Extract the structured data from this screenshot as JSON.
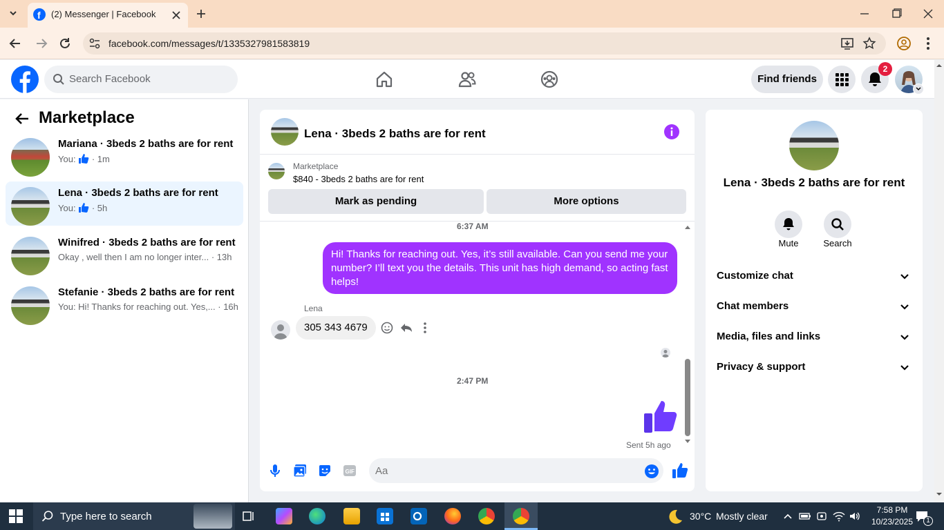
{
  "browser": {
    "tab_title": "(2) Messenger | Facebook",
    "url": "facebook.com/messages/t/1335327981583819"
  },
  "fb": {
    "search_placeholder": "Search Facebook",
    "find_friends": "Find friends",
    "notification_count": "2"
  },
  "left": {
    "title": "Marketplace",
    "conversations": [
      {
        "title": "Mariana · 3beds 2 baths are for rent",
        "prefix": "You:",
        "time": "· 1m"
      },
      {
        "title": "Lena · 3beds 2 baths are for rent",
        "prefix": "You:",
        "time": "· 5h"
      },
      {
        "title": "Winifred · 3beds 2 baths are for rent",
        "snippet": "Okay , well then I am no longer inter... · 13h"
      },
      {
        "title": "Stefanie · 3beds 2 baths are for rent",
        "snippet": "You: Hi! Thanks for reaching out. Yes,... · 16h"
      }
    ]
  },
  "chat": {
    "title": "Lena · 3beds 2 baths are for rent",
    "listing_source": "Marketplace",
    "listing_title": "$840 - 3beds 2 baths are for rent",
    "mark_pending": "Mark as pending",
    "more_options": "More options",
    "time1": "6:37 AM",
    "outgoing_message": "Hi! Thanks for reaching out. Yes, it’s still available. Can you send me your number? I’ll text you the details. This unit has high demand, so acting fast helps!",
    "sender_name": "Lena",
    "incoming_message": "305 343 4679",
    "time2": "2:47 PM",
    "sent_status": "Sent 5h ago",
    "input_placeholder": "Aa"
  },
  "right": {
    "name": "Lena · 3beds 2 baths are for rent",
    "mute": "Mute",
    "search": "Search",
    "sections": [
      "Customize chat",
      "Chat members",
      "Media, files and links",
      "Privacy & support"
    ]
  },
  "taskbar": {
    "search_placeholder": "Type here to search",
    "weather_temp": "30°C",
    "weather_desc": "Mostly clear",
    "time": "7:58 PM",
    "date": "10/23/2025",
    "notif_count": "1"
  },
  "colors": {
    "accent_purple": "#a033ff",
    "fb_blue": "#0866ff",
    "like_blue": "#0866ff",
    "notif_red": "#e41e3f"
  }
}
